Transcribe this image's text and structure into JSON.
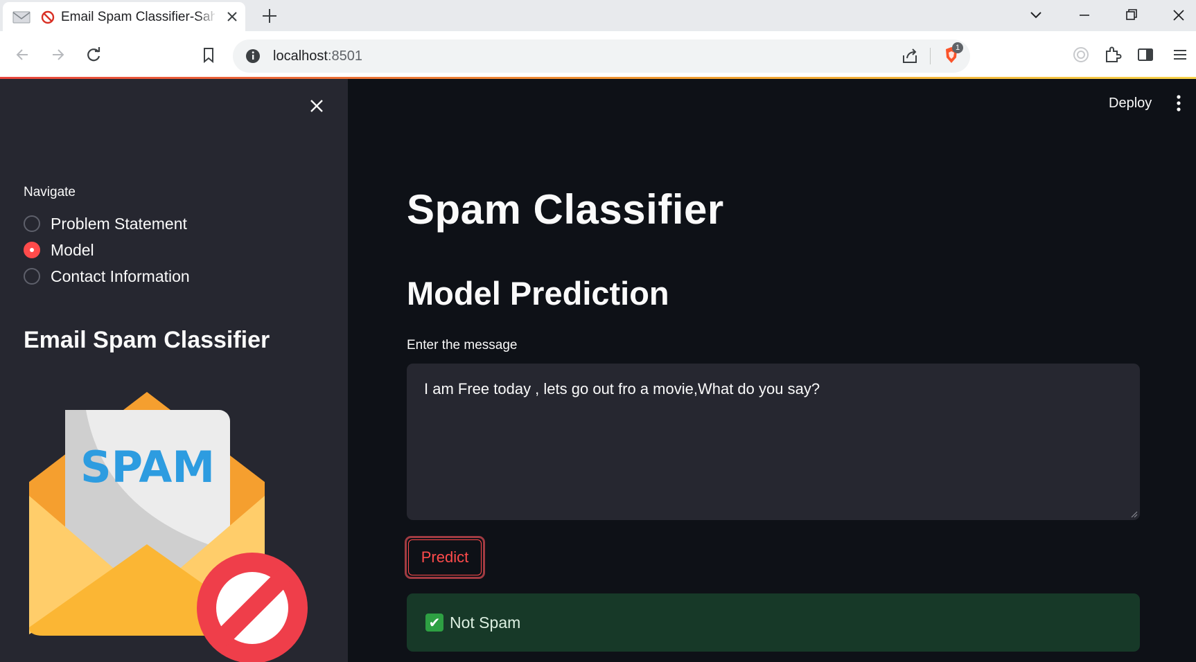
{
  "browser": {
    "tab_title": "Email Spam Classifier-Sahil T",
    "url_host": "localhost",
    "url_port": ":8501",
    "extension_badge": "1"
  },
  "header": {
    "deploy_label": "Deploy"
  },
  "sidebar": {
    "nav_label": "Navigate",
    "options": [
      {
        "label": "Problem Statement",
        "selected": false
      },
      {
        "label": "Model",
        "selected": true
      },
      {
        "label": "Contact Information",
        "selected": false
      }
    ],
    "title": "Email Spam Classifier",
    "image_text": "SPAM"
  },
  "main": {
    "title": "Spam Classifier",
    "subtitle": "Model Prediction",
    "input_label": "Enter the message",
    "input_value": "I am Free today , lets go out fro a movie,What do you say?",
    "predict_label": "Predict",
    "result_icon": "✔",
    "result_text": "Not Spam"
  },
  "colors": {
    "accent": "#ff4b4b",
    "sidebar_bg": "#262730",
    "main_bg": "#0e1117",
    "success_bg": "#173928"
  }
}
